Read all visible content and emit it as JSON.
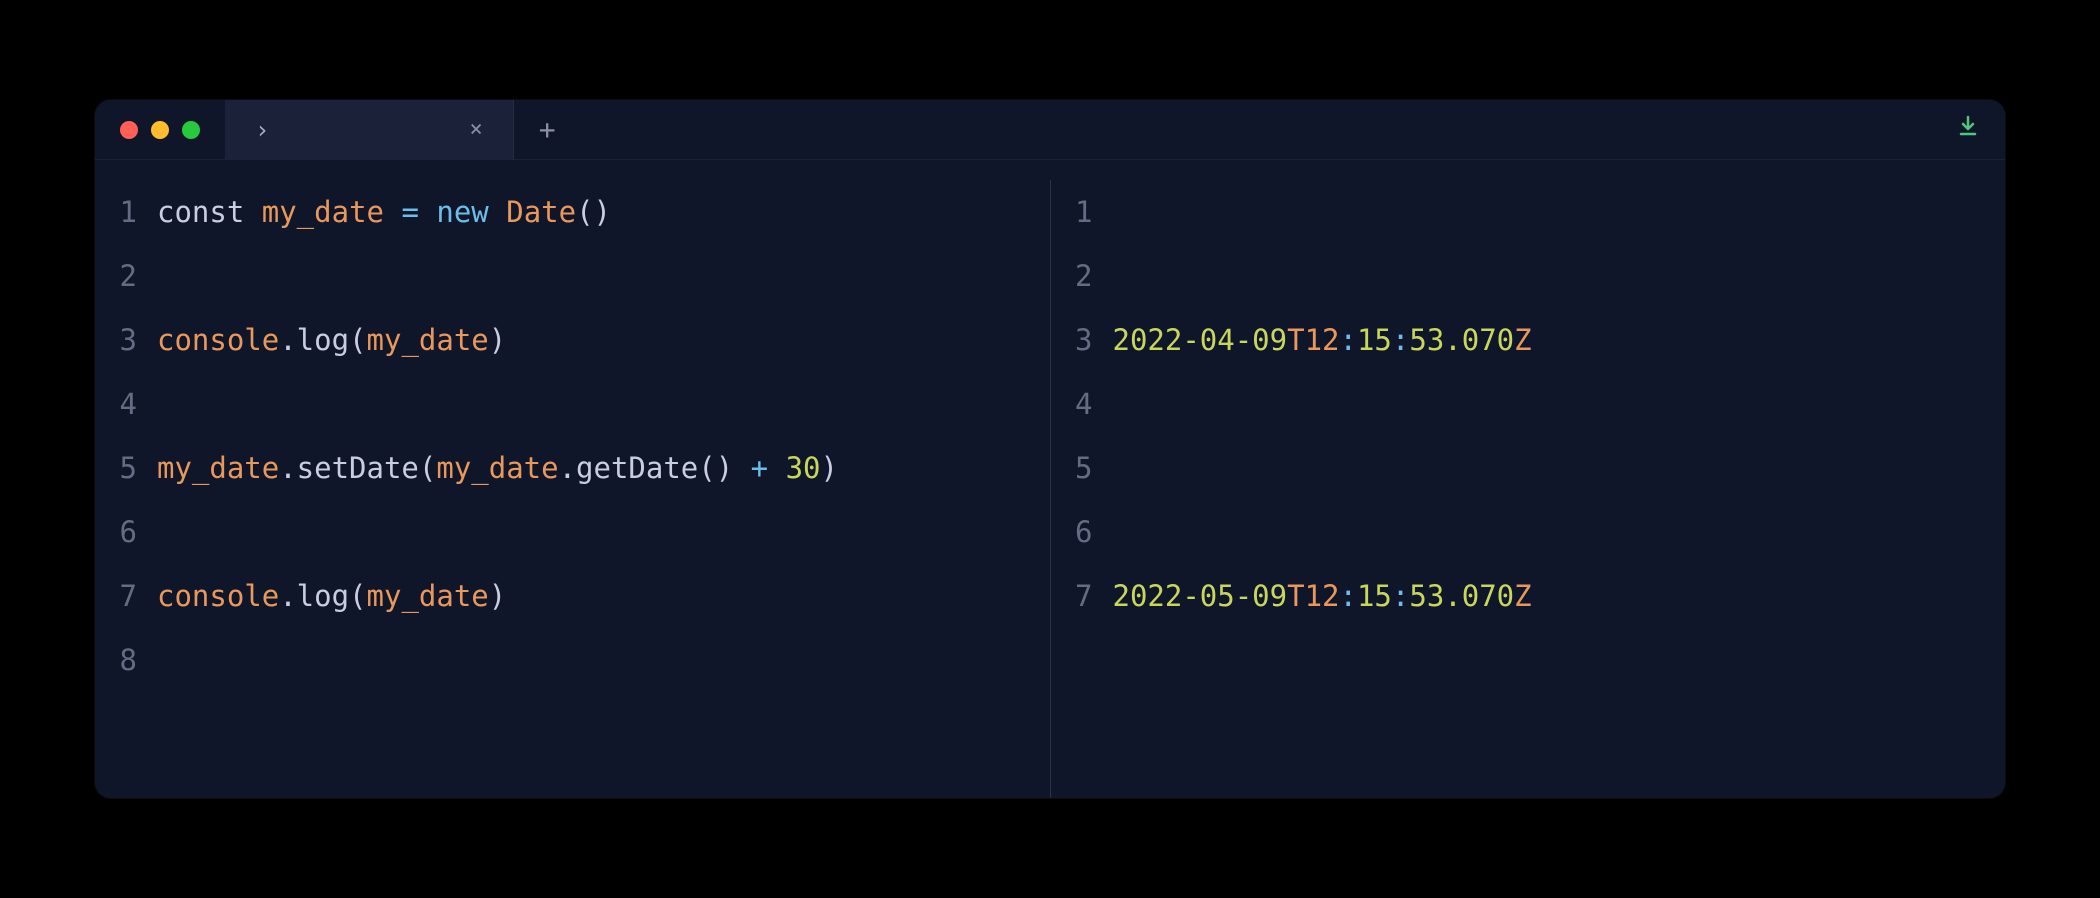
{
  "titlebar": {
    "tab_title": "›",
    "close_symbol": "×",
    "new_tab_symbol": "+"
  },
  "left_pane": {
    "lines": [
      {
        "num": "1",
        "tokens": [
          {
            "cls": "tok-keyword",
            "t": "const "
          },
          {
            "cls": "tok-var",
            "t": "my_date"
          },
          {
            "cls": "",
            "t": " "
          },
          {
            "cls": "tok-op",
            "t": "="
          },
          {
            "cls": "",
            "t": " "
          },
          {
            "cls": "tok-op",
            "t": "new"
          },
          {
            "cls": "",
            "t": " "
          },
          {
            "cls": "tok-class",
            "t": "Date"
          },
          {
            "cls": "tok-paren",
            "t": "()"
          }
        ]
      },
      {
        "num": "2",
        "tokens": []
      },
      {
        "num": "3",
        "tokens": [
          {
            "cls": "tok-obj",
            "t": "console"
          },
          {
            "cls": "tok-method",
            "t": ".log("
          },
          {
            "cls": "tok-var",
            "t": "my_date"
          },
          {
            "cls": "tok-paren",
            "t": ")"
          }
        ]
      },
      {
        "num": "4",
        "tokens": []
      },
      {
        "num": "5",
        "tokens": [
          {
            "cls": "tok-var",
            "t": "my_date"
          },
          {
            "cls": "tok-method",
            "t": ".setDate("
          },
          {
            "cls": "tok-var",
            "t": "my_date"
          },
          {
            "cls": "tok-method",
            "t": ".getDate()"
          },
          {
            "cls": "",
            "t": " "
          },
          {
            "cls": "tok-op",
            "t": "+"
          },
          {
            "cls": "",
            "t": " "
          },
          {
            "cls": "tok-num",
            "t": "30"
          },
          {
            "cls": "tok-paren",
            "t": ")"
          }
        ]
      },
      {
        "num": "6",
        "tokens": []
      },
      {
        "num": "7",
        "tokens": [
          {
            "cls": "tok-obj",
            "t": "console"
          },
          {
            "cls": "tok-method",
            "t": ".log("
          },
          {
            "cls": "tok-var",
            "t": "my_date"
          },
          {
            "cls": "tok-paren",
            "t": ")"
          }
        ]
      },
      {
        "num": "8",
        "tokens": []
      }
    ]
  },
  "right_pane": {
    "lines": [
      {
        "num": "1",
        "tokens": []
      },
      {
        "num": "2",
        "tokens": []
      },
      {
        "num": "3",
        "tokens": [
          {
            "cls": "tok-date",
            "t": "2022-04-09"
          },
          {
            "cls": "tok-t",
            "t": "T12"
          },
          {
            "cls": "tok-colon",
            "t": ":"
          },
          {
            "cls": "tok-date",
            "t": "15"
          },
          {
            "cls": "tok-colon",
            "t": ":"
          },
          {
            "cls": "tok-date",
            "t": "53.070"
          },
          {
            "cls": "tok-z",
            "t": "Z"
          }
        ]
      },
      {
        "num": "4",
        "tokens": []
      },
      {
        "num": "5",
        "tokens": []
      },
      {
        "num": "6",
        "tokens": []
      },
      {
        "num": "7",
        "tokens": [
          {
            "cls": "tok-date",
            "t": "2022-05-09"
          },
          {
            "cls": "tok-t",
            "t": "T12"
          },
          {
            "cls": "tok-colon",
            "t": ":"
          },
          {
            "cls": "tok-date",
            "t": "15"
          },
          {
            "cls": "tok-colon",
            "t": ":"
          },
          {
            "cls": "tok-date",
            "t": "53.070"
          },
          {
            "cls": "tok-z",
            "t": "Z"
          }
        ]
      }
    ]
  }
}
